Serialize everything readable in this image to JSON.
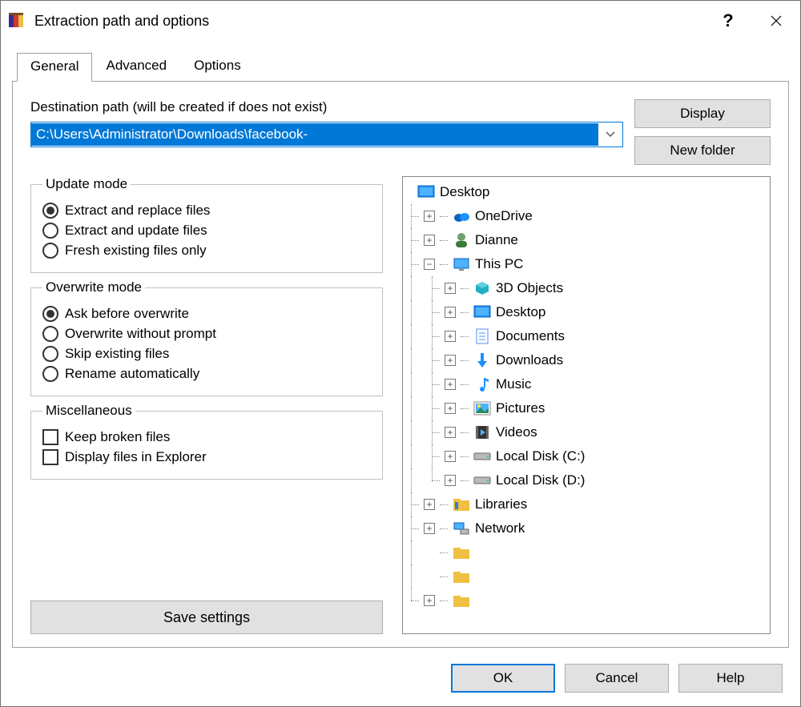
{
  "window": {
    "title": "Extraction path and options"
  },
  "tabs": {
    "general": "General",
    "advanced": "Advanced",
    "options": "Options"
  },
  "dest": {
    "label": "Destination path (will be created if does not exist)",
    "value": "C:\\Users\\Administrator\\Downloads\\facebook-",
    "display_button": "Display",
    "newfolder_button": "New folder"
  },
  "update_mode": {
    "legend": "Update mode",
    "opt1": "Extract and replace files",
    "opt2": "Extract and update files",
    "opt3": "Fresh existing files only",
    "selected": 0
  },
  "overwrite_mode": {
    "legend": "Overwrite mode",
    "opt1": "Ask before overwrite",
    "opt2": "Overwrite without prompt",
    "opt3": "Skip existing files",
    "opt4": "Rename automatically",
    "selected": 0
  },
  "misc": {
    "legend": "Miscellaneous",
    "opt1": "Keep broken files",
    "opt2": "Display files in Explorer"
  },
  "save_settings": "Save settings",
  "tree": {
    "desktop": "Desktop",
    "onedrive": "OneDrive",
    "user": "Dianne",
    "thispc": "This PC",
    "threed": "3D Objects",
    "desktop2": "Desktop",
    "documents": "Documents",
    "downloads": "Downloads",
    "music": "Music",
    "pictures": "Pictures",
    "videos": "Videos",
    "diskc": "Local Disk (C:)",
    "diskd": "Local Disk (D:)",
    "libraries": "Libraries",
    "network": "Network"
  },
  "footer": {
    "ok": "OK",
    "cancel": "Cancel",
    "help": "Help"
  }
}
